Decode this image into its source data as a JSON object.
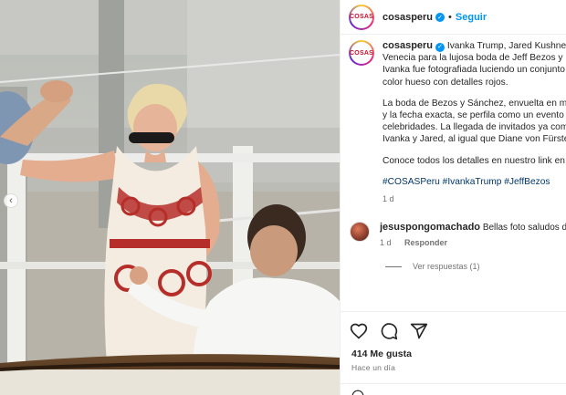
{
  "photo": {
    "alt": "",
    "prev_icon": "chevron-left-icon"
  },
  "header": {
    "avatar_text": "COSAS",
    "username": "cosasperu",
    "verified_icon": "verified-badge-icon",
    "separator": "•",
    "follow_label": "Seguir"
  },
  "caption": {
    "username": "cosasperu",
    "line1": "Ivanka Trump, Jared Kushner y s",
    "line2": "Venecia para la lujosa boda de Jeff Bezos y La",
    "line3": "Ivanka fue fotografiada luciendo un conjunto",
    "line4": "color hueso con detalles rojos.",
    "p2_line1": "La boda de Bezos y Sánchez, envuelta en mist",
    "p2_line2": "y la fecha exacta, se perfila como un evento ll",
    "p2_line3": "celebridades. La llegada de invitados ya come",
    "p2_line4": "Ivanka y Jared, al igual que Diane von Fürsten",
    "p3": "Conoce todos los detalles en nuestro link en b",
    "hashtags": "#COSASPeru #IvankaTrump #JeffBezos",
    "time": "1 d"
  },
  "comment": {
    "username": "jesuspongomachado",
    "text": "Bellas foto saludos desd",
    "time": "1 d",
    "reply_label": "Responder",
    "view_replies": "Ver respuestas (1)"
  },
  "actions": {
    "like_icon": "heart-icon",
    "comment_icon": "comment-icon",
    "share_icon": "share-icon"
  },
  "likes": "414 Me gusta",
  "posted_ago": "Hace un día",
  "colors": {
    "accent": "#0095f6",
    "text": "#262626",
    "muted": "#737373",
    "hashtag": "#00376b"
  }
}
